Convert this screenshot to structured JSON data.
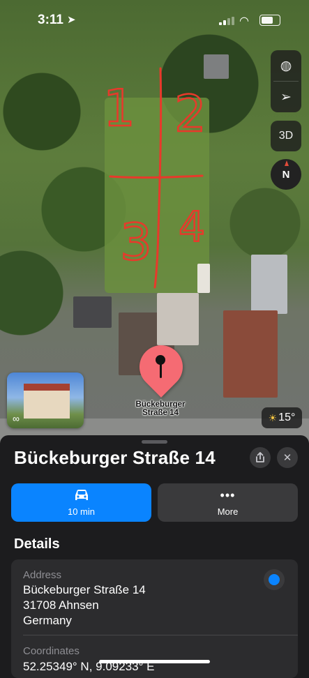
{
  "status": {
    "time": "3:11"
  },
  "map": {
    "sketch_numbers": [
      "1",
      "2",
      "3",
      "4"
    ],
    "pin_label": "Bückeburger Straße 14",
    "controls": {
      "three_d_label": "3D",
      "compass_label": "N"
    },
    "weather": {
      "temperature": "15°"
    }
  },
  "place": {
    "title": "Bückeburger Straße 14",
    "actions": [
      {
        "label": "10 min",
        "icon": "car-icon"
      },
      {
        "label": "More",
        "icon": "ellipsis-icon"
      }
    ],
    "details_heading": "Details",
    "address": {
      "label": "Address",
      "line1": "Bückeburger Straße 14",
      "line2": "31708 Ahnsen",
      "line3": "Germany"
    },
    "coordinates": {
      "label": "Coordinates",
      "value": "52.25349° N, 9.09233° E"
    }
  },
  "colors": {
    "accent": "#0a84ff",
    "pin": "#f56b73",
    "sheet": "#1c1c1e",
    "card": "#2c2c2e",
    "sketch": "#e8392b"
  }
}
